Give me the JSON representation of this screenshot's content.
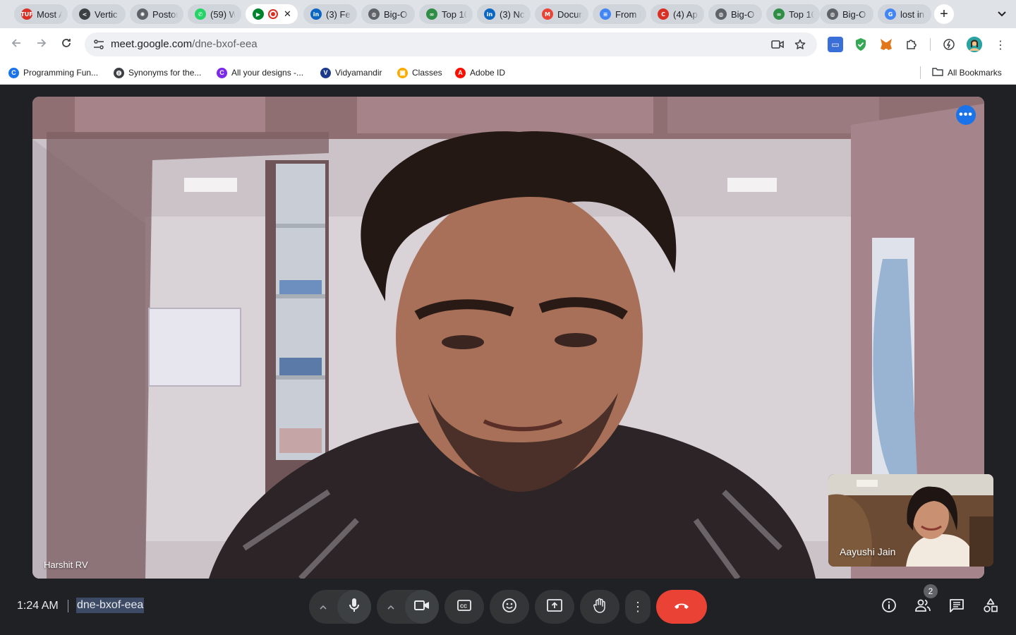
{
  "browser": {
    "tabs": [
      {
        "title": "Most A",
        "icon": "tuf-icon",
        "color": "#d93025",
        "badge": "TUF"
      },
      {
        "title": "Vertic",
        "icon": "vertical-logo-icon",
        "color": "#3c4043",
        "badge": "<"
      },
      {
        "title": "Postor",
        "icon": "openai-icon",
        "color": "#5f6368",
        "badge": "✺"
      },
      {
        "title": "(59) W",
        "icon": "whatsapp-icon",
        "color": "#25d366",
        "badge": "✆"
      },
      {
        "title": "",
        "icon": "google-meet-icon",
        "color": "#00832d",
        "badge": "▶",
        "active": true
      },
      {
        "title": "(3) Fe",
        "icon": "linkedin-icon",
        "color": "#0a66c2",
        "badge": "in"
      },
      {
        "title": "Big-O",
        "icon": "globe-icon",
        "color": "#5f6368",
        "badge": "◍"
      },
      {
        "title": "Top 10",
        "icon": "geeksforgeeks-icon",
        "color": "#2f8d46",
        "badge": "∞"
      },
      {
        "title": "(3) Nc",
        "icon": "linkedin-icon",
        "color": "#0a66c2",
        "badge": "in"
      },
      {
        "title": "Docur",
        "icon": "gmail-icon",
        "color": "#ea4335",
        "badge": "M"
      },
      {
        "title": "From I",
        "icon": "google-docs-icon",
        "color": "#4285f4",
        "badge": "≡"
      },
      {
        "title": "(4) Ap",
        "icon": "coursera-icon",
        "color": "#d93025",
        "badge": "C"
      },
      {
        "title": "Big-O",
        "icon": "globe-icon",
        "color": "#5f6368",
        "badge": "◍"
      },
      {
        "title": "Top 10",
        "icon": "geeksforgeeks-icon",
        "color": "#2f8d46",
        "badge": "∞"
      },
      {
        "title": "Big-O",
        "icon": "globe-icon",
        "color": "#5f6368",
        "badge": "◍"
      },
      {
        "title": "lost in",
        "icon": "google-icon",
        "color": "#4285f4",
        "badge": "G"
      }
    ],
    "new_tab": "+",
    "tab_menu": "⌄",
    "url_host": "meet.google.com",
    "url_path": "/dne-bxof-eea",
    "bookmarks": [
      {
        "label": "Programming Fun...",
        "icon": "coursera-icon",
        "color": "#1a73e8",
        "badge": "C"
      },
      {
        "label": "Synonyms for the...",
        "icon": "globe-icon",
        "color": "#3c4043",
        "badge": "◍"
      },
      {
        "label": "All your designs -...",
        "icon": "canva-icon",
        "color": "#7d2ae8",
        "badge": "C"
      },
      {
        "label": "Vidyamandir",
        "icon": "vidyamandir-icon",
        "color": "#1b3a8c",
        "badge": "V"
      },
      {
        "label": "Classes",
        "icon": "google-classroom-icon",
        "color": "#f9ab00",
        "badge": "▣"
      },
      {
        "label": "Adobe ID",
        "icon": "adobe-icon",
        "color": "#fa0f00",
        "badge": "A"
      }
    ],
    "all_bookmarks": "All Bookmarks"
  },
  "meet": {
    "main_participant": "Harshit RV",
    "self_participant": "Aayushi Jain",
    "time": "1:24 AM",
    "meeting_code": "dne-bxof-eea",
    "participant_count": "2"
  },
  "colors": {
    "leave": "#ea4335",
    "accent": "#1a73e8",
    "stage_bg": "#202124"
  }
}
